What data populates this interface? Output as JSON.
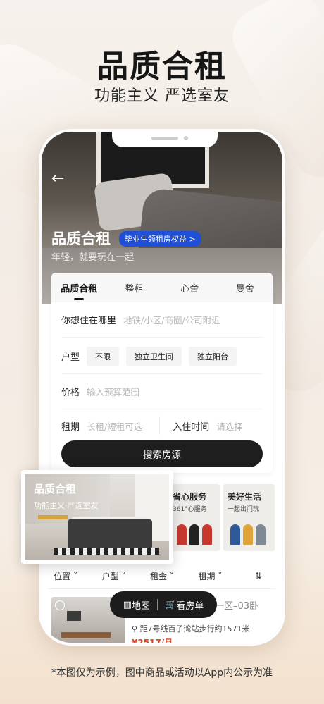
{
  "header": {
    "title": "品质合租",
    "subtitle": "功能主义 严选室友"
  },
  "hero": {
    "back": "←",
    "title": "品质合租",
    "badge": "毕业生领租房权益 >",
    "slogan": "年轻，就要玩在一起"
  },
  "tabs": [
    {
      "label": "品质合租",
      "active": true
    },
    {
      "label": "整租",
      "active": false
    },
    {
      "label": "心舍",
      "active": false
    },
    {
      "label": "曼舍",
      "active": false
    }
  ],
  "form": {
    "location_label": "你想住在哪里",
    "location_placeholder": "地铁/小区/商圈/公司附近",
    "room_type_label": "户型",
    "room_type_options": [
      "不限",
      "独立卫生间",
      "独立阳台"
    ],
    "price_label": "价格",
    "price_placeholder": "输入预算范围",
    "lease_label": "租期",
    "lease_placeholder": "长租/短租可选",
    "checkin_label": "入住时间",
    "checkin_placeholder": "请选择",
    "search_button": "搜索房源"
  },
  "services": [
    {
      "title": "省心服务",
      "desc": "361°心服务"
    },
    {
      "title": "美好生活",
      "desc": "一起出门玩"
    }
  ],
  "filters": [
    "位置 ˅",
    "户型 ˅",
    "租金 ˅",
    "租期 ˅",
    "⇅"
  ],
  "listing": {
    "title": "一区–03卧",
    "distance": "距7号线百子湾站步行约1571米",
    "price": "¥2517/月"
  },
  "mapbar": {
    "map_label": "地图",
    "list_label": "看房单"
  },
  "floating_card": {
    "title": "品质合租",
    "subtitle": "功能主义·严选室友"
  },
  "footnote": "*本图仅为示例，图中商品或活动以App内公示为准",
  "colors": {
    "accent_blue": "#1f4fd6",
    "dark_button": "#1e1e1e",
    "price": "#e0451f"
  }
}
